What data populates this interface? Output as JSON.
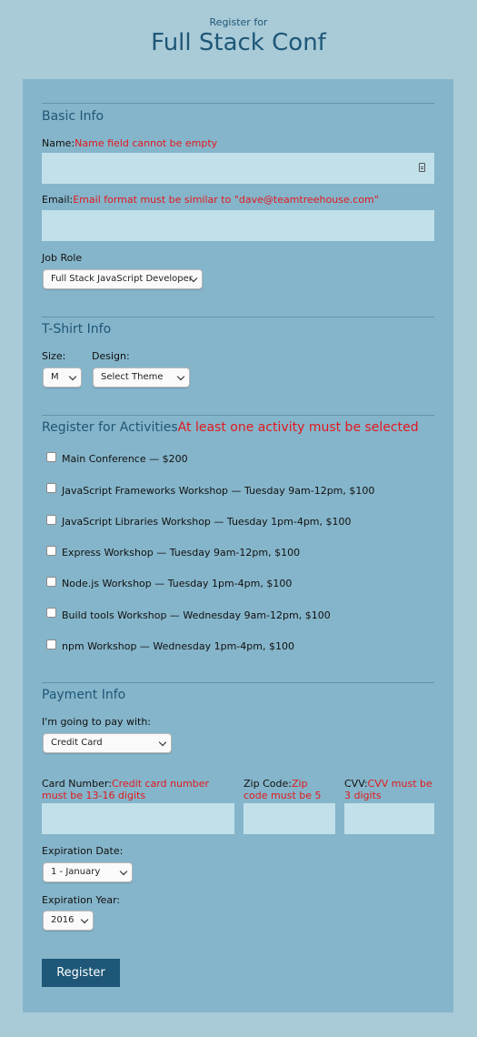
{
  "header": {
    "subtitle": "Register for",
    "title": "Full Stack Conf"
  },
  "basic_info": {
    "title": "Basic Info",
    "name_label": "Name:",
    "name_error": "Name field cannot be empty",
    "name_value": "",
    "email_label": "Email:",
    "email_error": "Email format must be similar to \"dave@teamtreehouse.com\"",
    "email_value": "",
    "job_role_label": "Job Role",
    "job_role_selected": "Full Stack JavaScript Developer"
  },
  "tshirt": {
    "title": "T-Shirt Info",
    "size_label": "Size:",
    "size_selected": "M",
    "design_label": "Design:",
    "design_selected": "Select Theme"
  },
  "activities": {
    "title": "Register for Activities",
    "error": "At least one activity must be selected",
    "items": [
      {
        "label": "Main Conference — $200",
        "checked": false
      },
      {
        "label": "JavaScript Frameworks Workshop — Tuesday 9am-12pm, $100",
        "checked": false
      },
      {
        "label": "JavaScript Libraries Workshop — Tuesday 1pm-4pm, $100",
        "checked": false
      },
      {
        "label": "Express Workshop — Tuesday 9am-12pm, $100",
        "checked": false
      },
      {
        "label": "Node.js Workshop — Tuesday 1pm-4pm, $100",
        "checked": false
      },
      {
        "label": "Build tools Workshop — Wednesday 9am-12pm, $100",
        "checked": false
      },
      {
        "label": "npm Workshop — Wednesday 1pm-4pm, $100",
        "checked": false
      }
    ]
  },
  "payment": {
    "title": "Payment Info",
    "pay_with_label": "I'm going to pay with:",
    "pay_with_selected": "Credit Card",
    "card_number_label": "Card Number:",
    "card_number_error": "Credit card number must be 13-16 digits",
    "zip_label": "Zip Code:",
    "zip_error": "Zip code must be 5 digits",
    "cvv_label": "CVV:",
    "cvv_error": "CVV must be 3 digits",
    "exp_date_label": "Expiration Date:",
    "exp_date_selected": "1 - January",
    "exp_year_label": "Expiration Year:",
    "exp_year_selected": "2016"
  },
  "submit_label": "Register",
  "colors": {
    "background": "#a9cad7",
    "panel": "#85b5ca",
    "accent": "#1e5777",
    "error": "#e1191f",
    "input": "#c1e0ea"
  }
}
